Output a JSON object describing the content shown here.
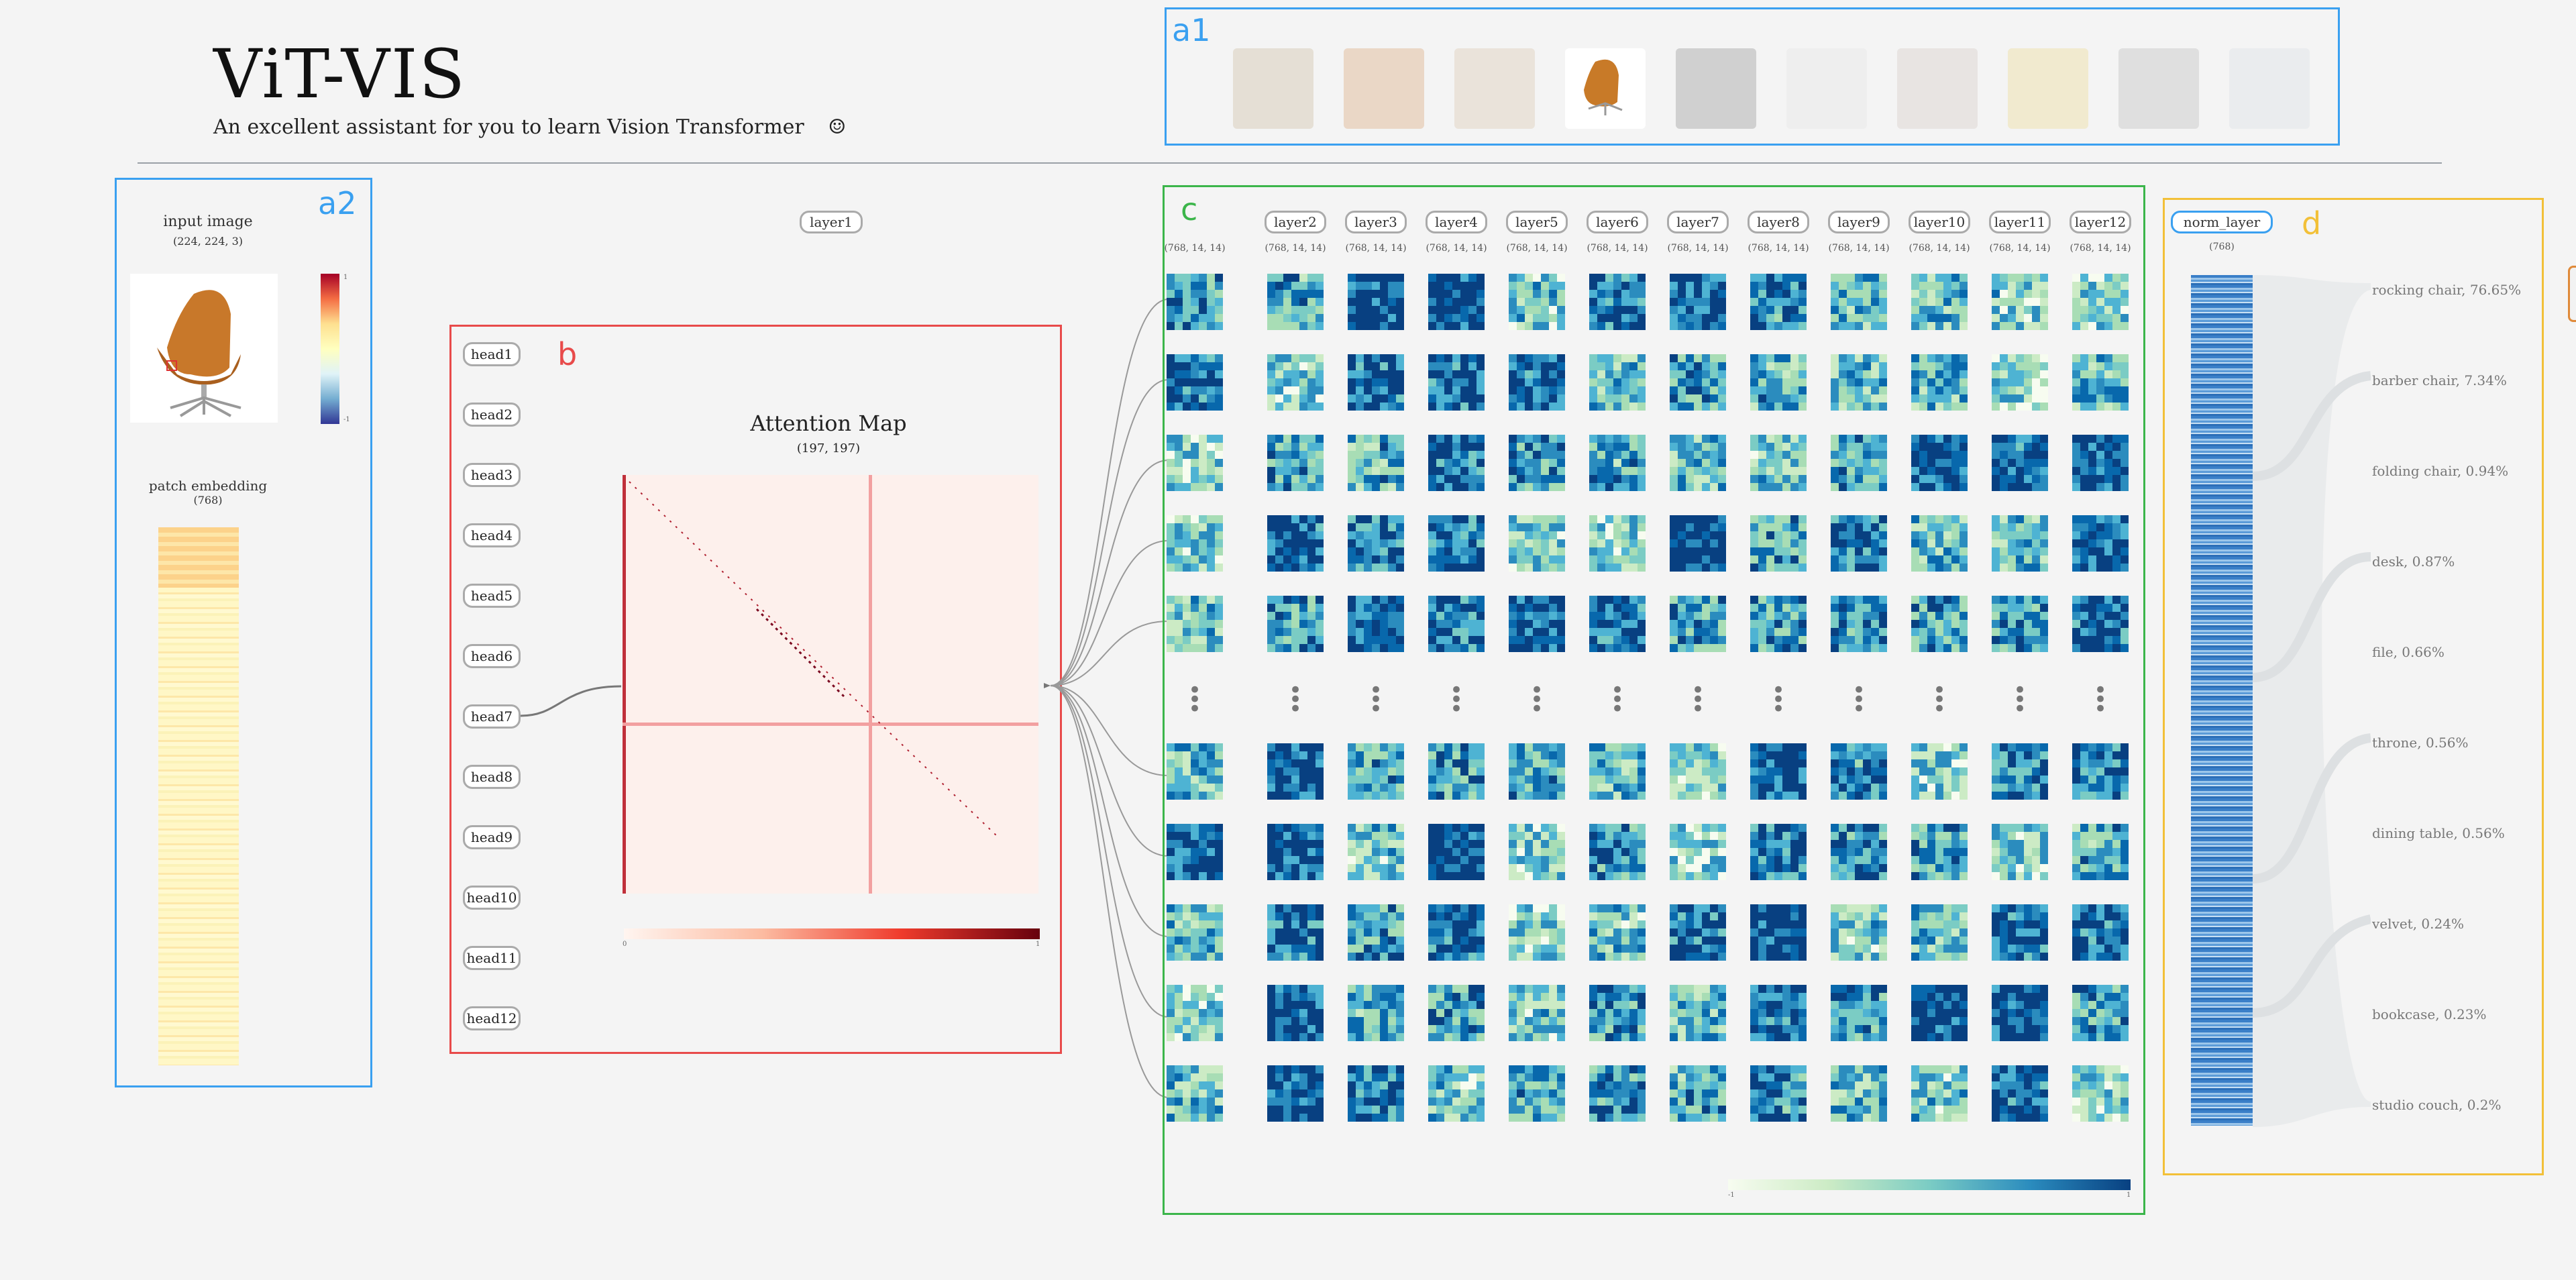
{
  "app": {
    "title": "ViT-VIS",
    "subtitle": "An excellent assistant for you to learn Vision Transformer",
    "subtitle_icon": "smile-icon"
  },
  "panels": {
    "a1": "a1",
    "a2": "a2",
    "b": "b",
    "c": "c",
    "d": "d"
  },
  "colors": {
    "a1": "#3aa0f0",
    "a2": "#3aa0f0",
    "b": "#e84a4a",
    "c": "#3bb54a",
    "d": "#f2c038"
  },
  "gallery": {
    "images": [
      {
        "name": "bird-image",
        "color": "#c9b89a"
      },
      {
        "name": "car-image",
        "color": "#d8a070"
      },
      {
        "name": "cat-image",
        "color": "#d8c2aa"
      },
      {
        "name": "chair-image",
        "color": "#c87a28",
        "selected": true
      },
      {
        "name": "dog-image",
        "color": "#8c8c8c"
      },
      {
        "name": "white-dog-image",
        "color": "#e2e2e2"
      },
      {
        "name": "horse-image",
        "color": "#d2c6c0"
      },
      {
        "name": "lemon-image",
        "color": "#ead78a"
      },
      {
        "name": "panda-image",
        "color": "#b8b8b8"
      },
      {
        "name": "shark-image",
        "color": "#d8dde2"
      }
    ]
  },
  "input": {
    "label": "input image",
    "shape": "(224, 224, 3)",
    "colorbar_max": "1",
    "colorbar_min": "-1",
    "embedding_label": "patch embedding",
    "embedding_shape": "(768)"
  },
  "attention": {
    "layer_chip": "layer1",
    "title": "Attention Map",
    "shape": "(197, 197)",
    "heads": [
      "head1",
      "head2",
      "head3",
      "head4",
      "head5",
      "head6",
      "head7",
      "head8",
      "head9",
      "head10",
      "head11",
      "head12"
    ],
    "selected_head": 6,
    "colorbar_min": "0",
    "colorbar_max": "1"
  },
  "layers": {
    "names": [
      "layer2",
      "layer3",
      "layer4",
      "layer5",
      "layer6",
      "layer7",
      "layer8",
      "layer9",
      "layer10",
      "layer11",
      "layer12"
    ],
    "shape": "(768, 14, 14)",
    "colorbar_min": "-1",
    "colorbar_max": "1"
  },
  "output": {
    "norm_chip": "norm_layer",
    "norm_shape": "(768)",
    "classes": [
      "rocking chair, 76.65%",
      "barber chair, 7.34%",
      "folding chair, 0.94%",
      "desk, 0.87%",
      "file, 0.66%",
      "throne, 0.56%",
      "dining table, 0.56%",
      "velvet, 0.24%",
      "bookcase, 0.23%",
      "studio couch, 0.2%"
    ]
  }
}
